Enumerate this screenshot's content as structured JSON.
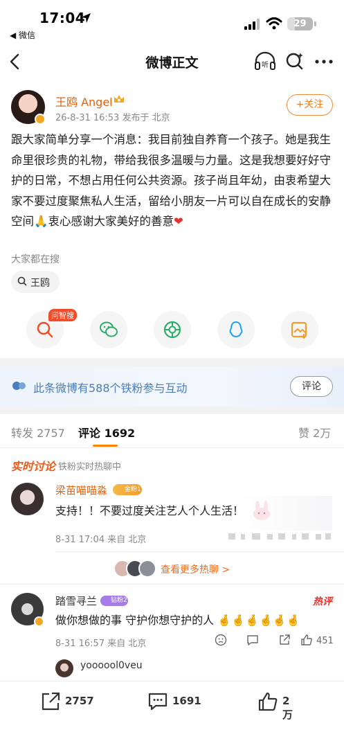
{
  "status_bar": {
    "time": "17:04",
    "back_app": "◀ 微信",
    "battery": "29"
  },
  "nav": {
    "title": "微博正文",
    "listen_icon": "headphones-icon",
    "search_icon": "search-icon",
    "more_icon": "more-icon"
  },
  "post": {
    "username": "王鸥 Angel",
    "meta": "26-8-31 16:53   发布于 北京",
    "follow_label": "+关注",
    "body": "跟大家简单分享一个消息：我目前独自养育一个孩子。她是我生命里很珍贵的礼物，带给我很多温暖与力量。这是我想要好好守护的日常，不想占用任何公共资源。孩子尚且年幼，由衷希望大家不要过度聚焦私人生活，留给小朋友一片可以自在成长的安静空间🙏衷心感谢大家美好的善意",
    "heart": "❤"
  },
  "search_hint": {
    "label": "大家都在搜",
    "chip": "王鸥"
  },
  "share": {
    "badge": "问智搜",
    "items": [
      "ai-search-icon",
      "wechat-icon",
      "moments-icon",
      "qq-icon",
      "save-image-icon"
    ]
  },
  "fan_bar": {
    "text": "此条微博有588个铁粉参与互动",
    "button": "评论"
  },
  "tabs": {
    "repost": "转发 2757",
    "comment": "评论 1692",
    "like": "赞 2万"
  },
  "realtime": {
    "title": "实时讨论",
    "subtitle": "铁粉实时热聊中"
  },
  "comment1": {
    "name": "梁苗喵喵淼",
    "badge": "金粉1",
    "text": "支持！！不要过度关注艺人个人生活！",
    "meta": "8-31 17:04  来自 北京"
  },
  "hot_link": "查看更多热聊 >",
  "comment2": {
    "name": "踏雪寻兰",
    "badge": "钻粉2",
    "hot_tag": "热评",
    "text": "做你想做的事 守护你想守护的人 🤞🤞🤞🤞🤞🤞",
    "meta": "8-31 16:57  来自 北京",
    "likes": "451"
  },
  "reply": {
    "name": "yoooool0veu"
  },
  "bottom": {
    "repost": "2757",
    "comment": "1691",
    "like": "2万"
  },
  "colors": {
    "accent": "#ff8200",
    "username": "#e8620c",
    "link_blue": "#4a7cc0"
  }
}
